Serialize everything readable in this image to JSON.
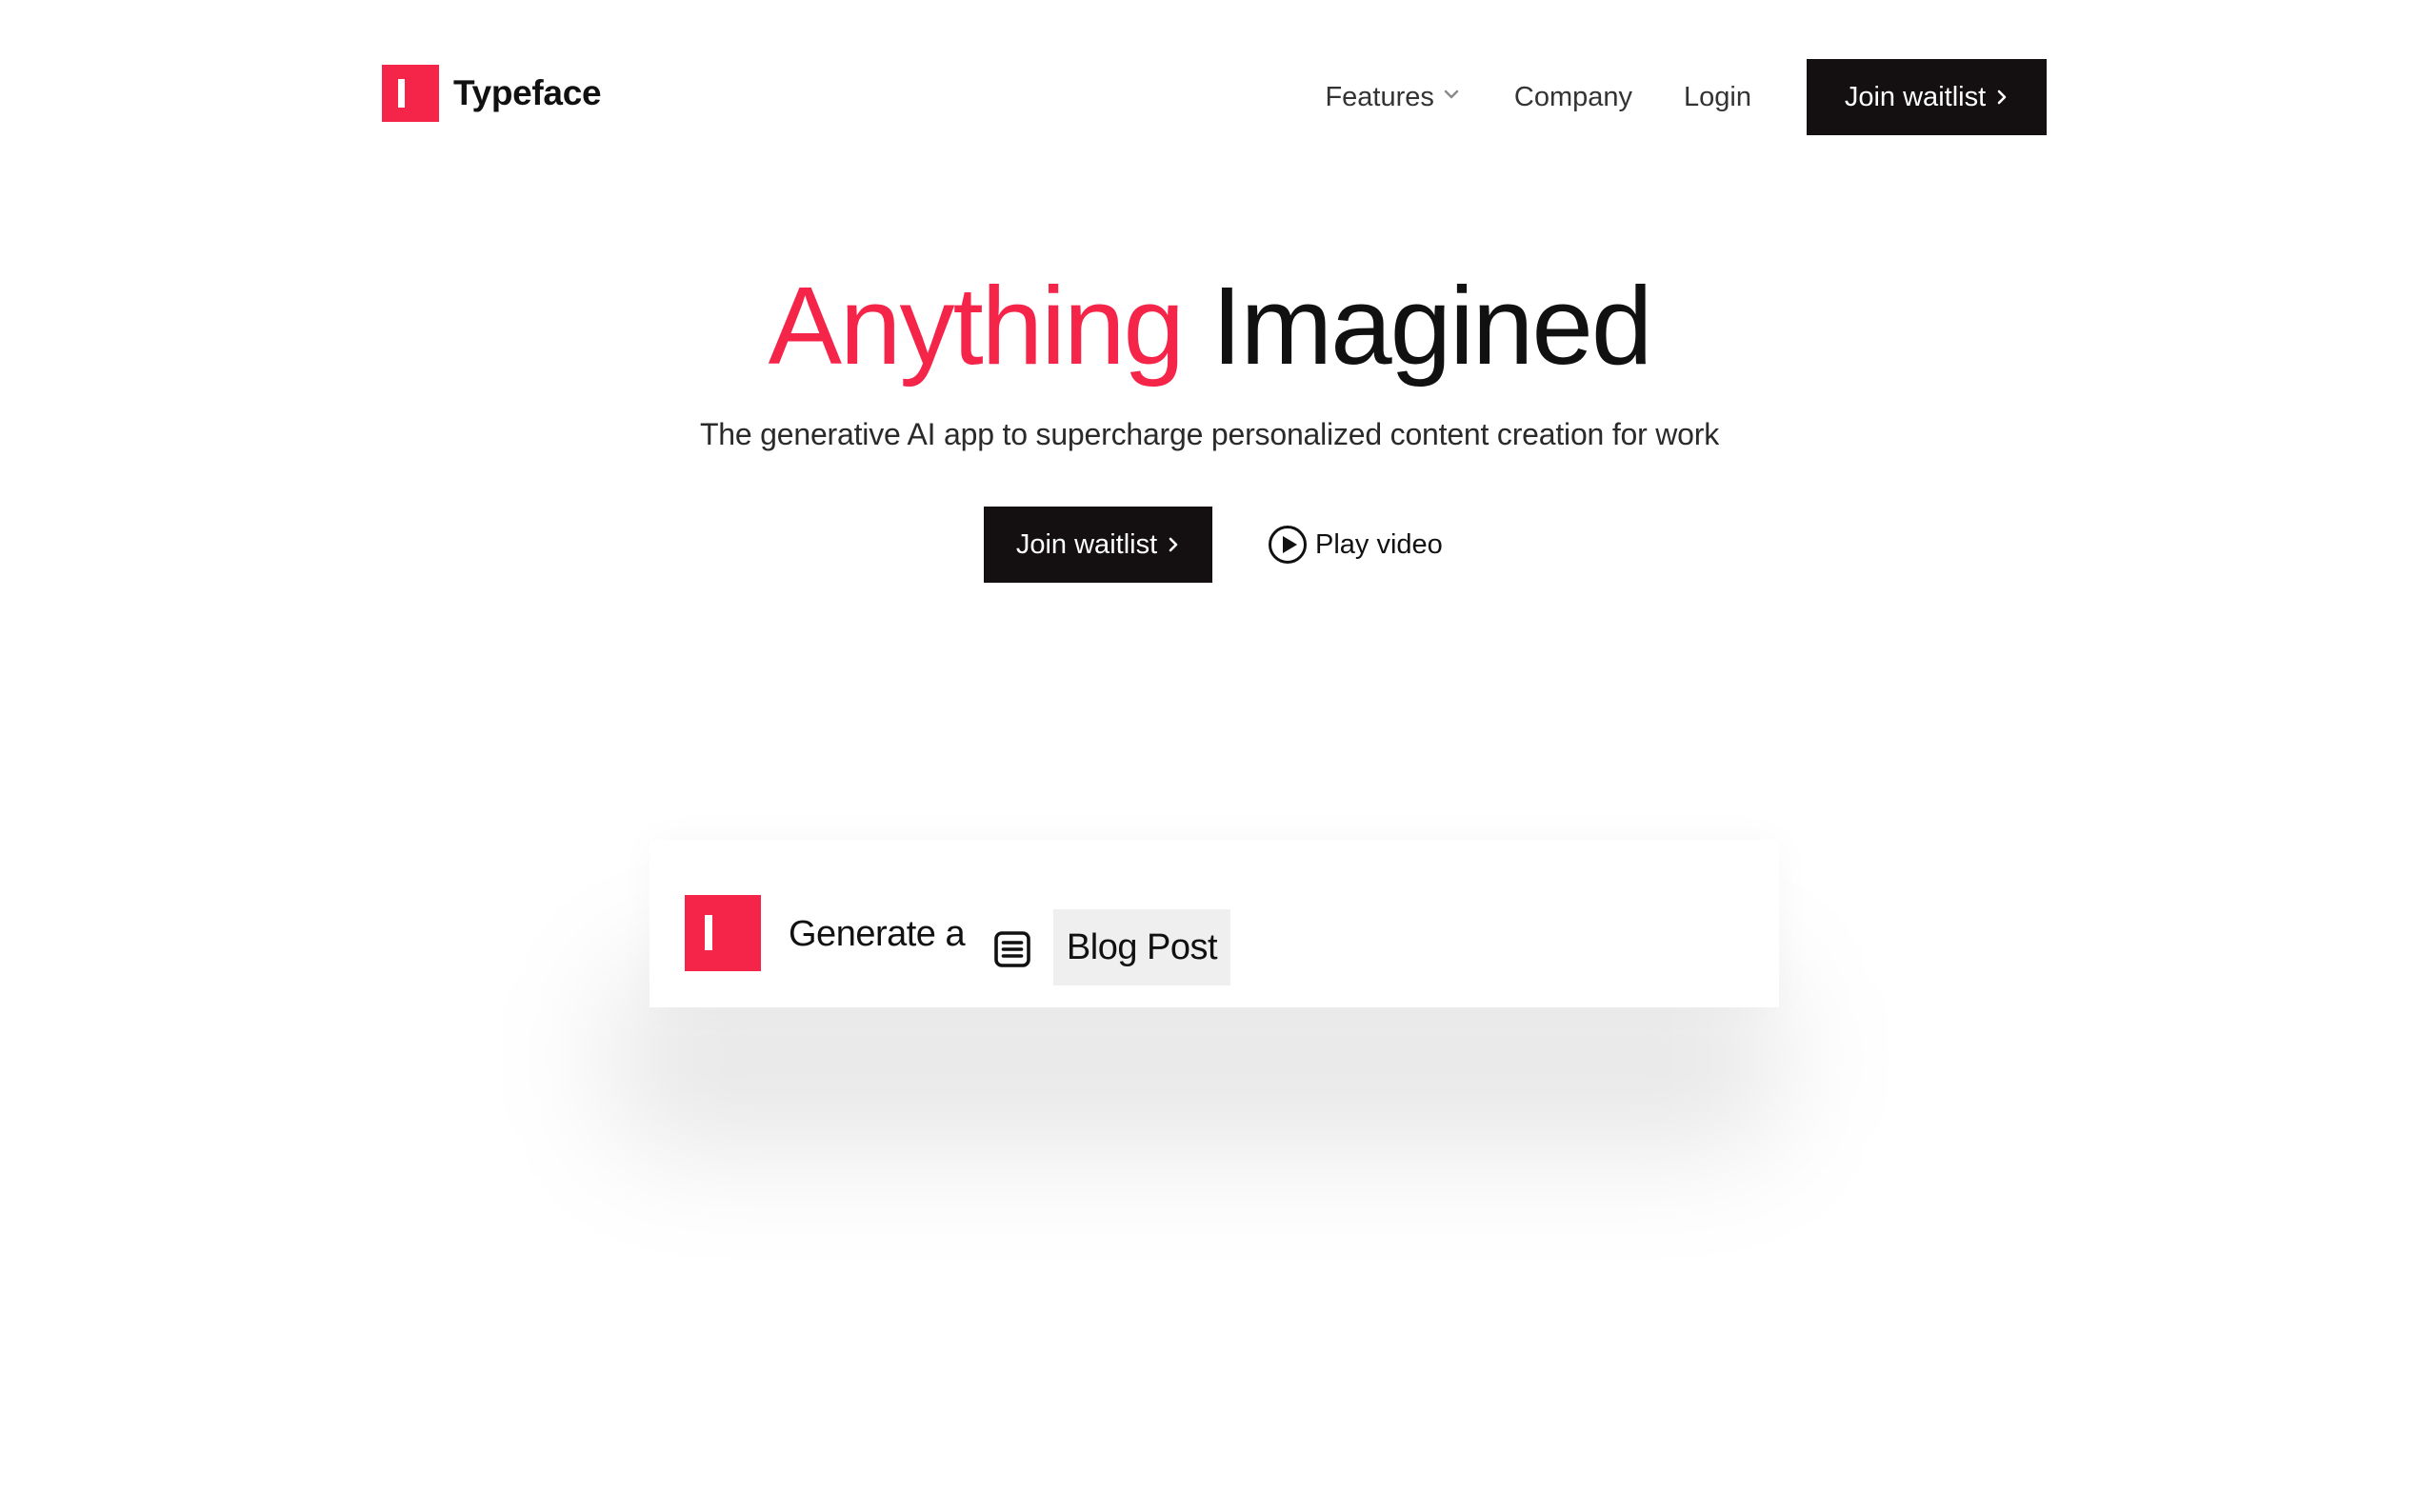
{
  "brand": {
    "name": "Typeface",
    "accent_color": "#f5254a",
    "dark_color": "#141012"
  },
  "nav": {
    "features_label": "Features",
    "company_label": "Company",
    "login_label": "Login",
    "cta_label": "Join waitlist"
  },
  "hero": {
    "title_accent": "Anything",
    "title_rest": "Imagined",
    "subtitle": "The generative AI app to supercharge personalized content creation for work",
    "cta_label": "Join waitlist",
    "play_label": "Play video"
  },
  "demo": {
    "prompt_text": "Generate a",
    "content_type_icon": "document-icon",
    "content_type_label": "Blog Post"
  }
}
